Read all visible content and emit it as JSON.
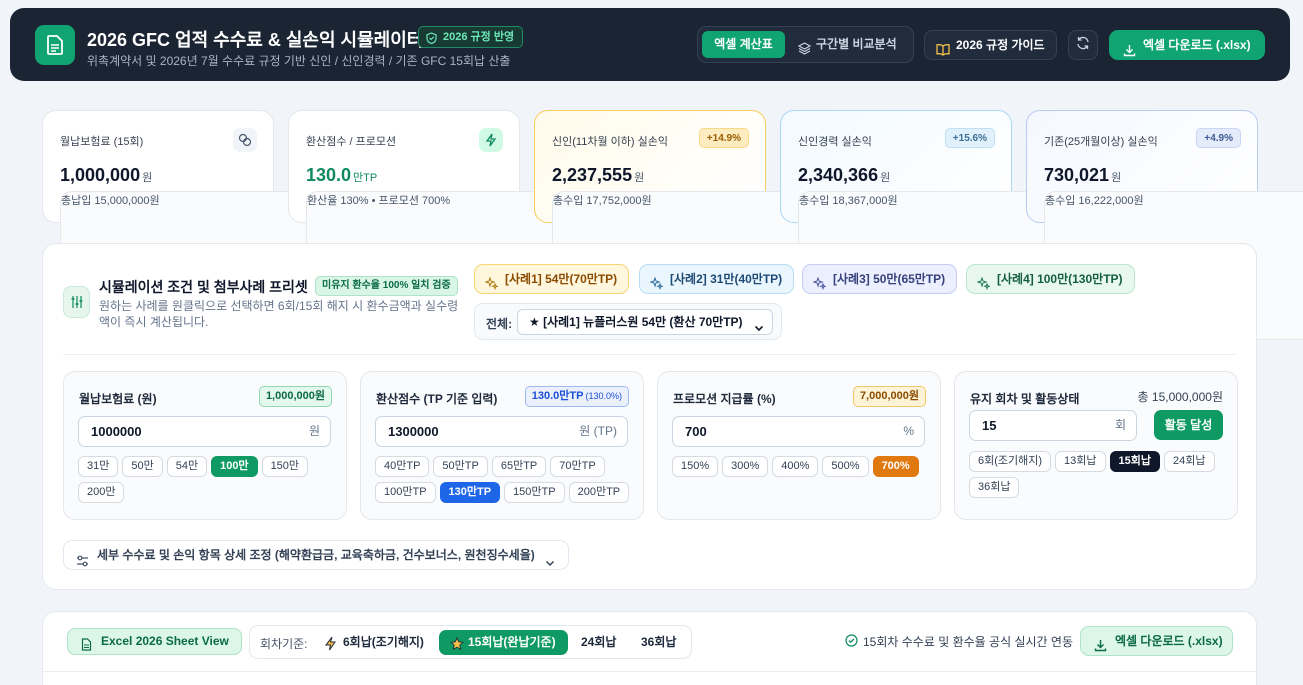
{
  "header": {
    "title": "2026 GFC 업적 수수료 & 실손익 시뮬레이터",
    "badge": "2026 규정 반영",
    "subtitle": "위촉계약서 및 2026년 7월 수수료 규정 기반 신인 / 신인경력 / 기존 GFC 15회납 산출",
    "tab_excel": "엑셀 계산표",
    "tab_compare": "구간별 비교분석",
    "guide_label": "2026 규정 가이드",
    "download_label": "엑셀 다운로드 (.xlsx)"
  },
  "stats": {
    "premium": {
      "label": "월납보험료 (15회)",
      "value": "1,000,000",
      "unit": "원",
      "sub": "총납입 15,000,000원"
    },
    "points": {
      "label": "환산점수 / 프로모션",
      "value": "130.0",
      "unit": "만TP",
      "sub": "환산율 130% • 프로모션 700%"
    },
    "rookie": {
      "label": "신인(11차월 이하) 실손익",
      "badge": "+14.9%",
      "value": "2,237,555",
      "unit": "원",
      "sub": "총수입 17,752,000원"
    },
    "experienced": {
      "label": "신인경력 실손익",
      "badge": "+15.6%",
      "value": "2,340,366",
      "unit": "원",
      "sub": "총수입 18,367,000원"
    },
    "existing": {
      "label": "기존(25개월이상) 실손익",
      "badge": "+4.9%",
      "value": "730,021",
      "unit": "원",
      "sub": "총수입 16,222,000원"
    }
  },
  "sim": {
    "title": "시뮬레이션 조건 및 첨부사례 프리셋",
    "badge": "미유지 환수율 100% 일치 검증",
    "desc": "원하는 사례를 원클릭으로 선택하면 6회/15회 해지 시 환수금액과 실수령액이 즉시 계산됩니다.",
    "presets": [
      "[사례1] 54만(70만TP)",
      "[사례2] 31만(40만TP)",
      "[사례3] 50만(65만TP)",
      "[사례4] 100만(130만TP)"
    ],
    "select_label": "전체:",
    "select_value": "★ [사례1] 뉴플러스원 54만 (환산 70만TP)",
    "premium": {
      "title": "월납보험료 (원)",
      "badge": "1,000,000원",
      "value": "1000000",
      "unit": "원",
      "chips": [
        "31만",
        "50만",
        "54만",
        "100만",
        "150만",
        "200만"
      ],
      "selected": "100만"
    },
    "points": {
      "title": "환산점수 (TP 기준 입력)",
      "badge": "130.0만TP",
      "badge_sub": "(130.0%)",
      "value": "1300000",
      "unit": "원 (TP)",
      "chips": [
        "40만TP",
        "50만TP",
        "65만TP",
        "70만TP",
        "100만TP",
        "130만TP",
        "150만TP",
        "200만TP"
      ],
      "selected": "130만TP"
    },
    "promo": {
      "title": "프로모션 지급률 (%)",
      "badge": "7,000,000원",
      "value": "700",
      "unit": "%",
      "chips": [
        "150%",
        "300%",
        "400%",
        "500%",
        "700%"
      ],
      "selected": "700%"
    },
    "retention": {
      "title": "유지 회차 및 활동상태",
      "total": "총 15,000,000원",
      "value": "15",
      "unit": "회",
      "action": "활동 달성",
      "chips": [
        "6회(조기해지)",
        "13회납",
        "15회납",
        "24회납",
        "36회납"
      ],
      "selected": "15회납"
    },
    "detail_label": "세부 수수료 및 손익 항목 상세 조정 (해약환급금, 교육축하금, 건수보너스, 원천징수세율)"
  },
  "sheet": {
    "tag": "Excel 2026 Sheet View",
    "basis_label": "회차기준:",
    "options": [
      "6회납(조기해지)",
      "15회납(완납기준)",
      "24회납",
      "36회납"
    ],
    "selected": "15회납(완납기준)",
    "sync_text": "15회차 수수료 및 환수율 공식 실시간 연동",
    "download_label": "엑셀 다운로드 (.xlsx)"
  },
  "colors": {
    "brand": "#10a472",
    "header_bg": "#1b2433",
    "accent_blue": "#1e66e8",
    "accent_orange": "#e07a10"
  }
}
